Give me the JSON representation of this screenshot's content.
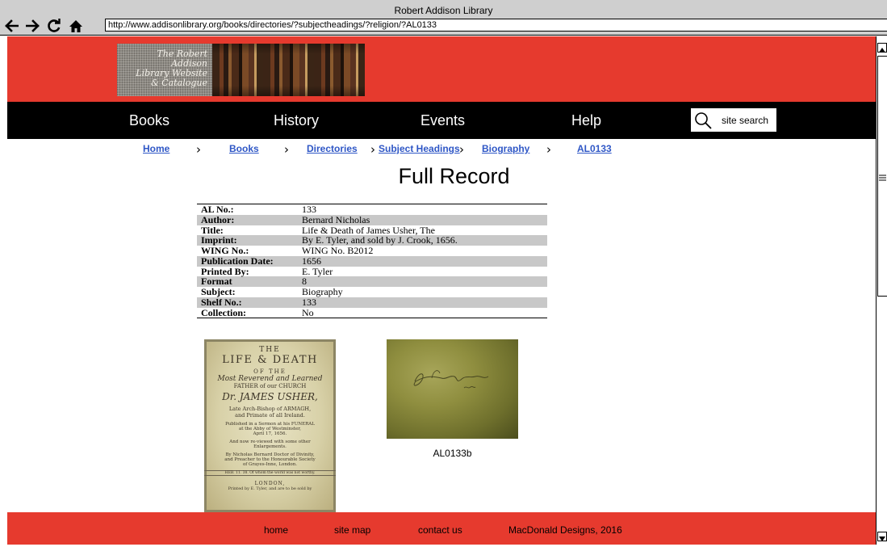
{
  "browser": {
    "window_title": "Robert Addison Library",
    "url": "http://www.addisonlibrary.org/books/directories/?subjectheadings/?religion/?AL0133",
    "back_icon": "arrow-left-icon",
    "forward_icon": "arrow-right-icon",
    "reload_icon": "reload-icon",
    "home_icon": "home-icon"
  },
  "header": {
    "logo_lines": [
      "The Robert Addison",
      "Library Website",
      "& Catalogue"
    ],
    "accent_color": "#e63a2e"
  },
  "nav": {
    "items": [
      "Books",
      "History",
      "Events",
      "Help"
    ],
    "search_placeholder": "site search"
  },
  "breadcrumb": {
    "items": [
      "Home",
      "Books",
      "Directories",
      "Subject Headings",
      "Biography",
      "AL0133"
    ]
  },
  "page_title": "Full Record",
  "record": {
    "rows": [
      {
        "key": "AL No.:",
        "value": "133"
      },
      {
        "key": "Author:",
        "value": "Bernard Nicholas"
      },
      {
        "key": "Title:",
        "value": "Life & Death of James Usher, The"
      },
      {
        "key": "Imprint:",
        "value": "By E. Tyler, and sold by J. Crook, 1656."
      },
      {
        "key": "WING No.:",
        "value": "WING No. B2012"
      },
      {
        "key": "Publication Date:",
        "value": "1656"
      },
      {
        "key": "Printed By:",
        "value": "E. Tyler"
      },
      {
        "key": "Format",
        "value": "8"
      },
      {
        "key": "Subject:",
        "value": "Biography"
      },
      {
        "key": "Shelf No.:",
        "value": "133"
      },
      {
        "key": "Collection:",
        "value": "No"
      }
    ]
  },
  "images": {
    "title_page_lines": [
      "THE",
      "LIFE & DEATH",
      "OF THE",
      "Most Reverend and Learned",
      "FATHER of our CHURCH",
      "Dr. JAMES USHER,",
      "Late Arch-Bishop of ARMAGH,",
      "and Primate of all Ireland.",
      "Published in a Sermon at his FUNERAL",
      "at the Abby of Westminster,",
      "April 17, 1656.",
      "And now re-viewed with some other",
      "Enlargements.",
      "By Nicholas Bernard Doctor of Divinity,",
      "and Preacher to the Honourable Society",
      "of Grayes-Inne, London.",
      "HEB. 11. 38. Of whom the world was not worthy.",
      "LONDON,",
      "Printed by E. Tyler, and are to be sold by"
    ],
    "signature_caption": "AL0133b"
  },
  "footer": {
    "items": [
      "home",
      "site map",
      "contact us",
      "MacDonald Designs, 2016"
    ]
  }
}
